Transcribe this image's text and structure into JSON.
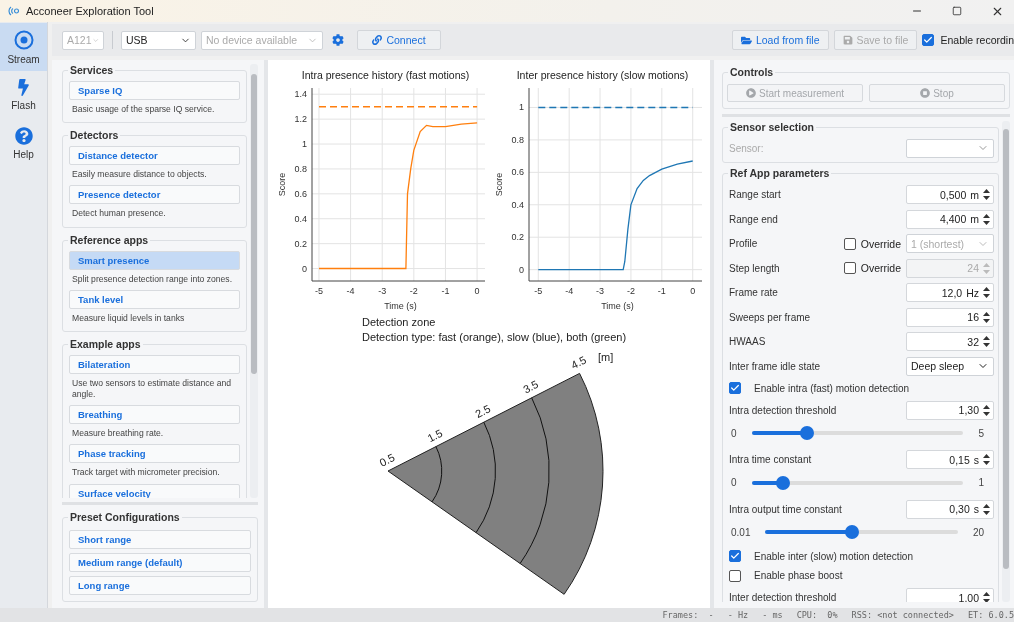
{
  "window": {
    "title": "Acconeer Exploration Tool"
  },
  "rail": [
    {
      "label": "Stream",
      "kind": "stream",
      "selected": true
    },
    {
      "label": "Flash",
      "kind": "flash",
      "selected": false
    },
    {
      "label": "Help",
      "kind": "help",
      "selected": false
    }
  ],
  "toolbar": {
    "left": [
      {
        "kind": "select",
        "value": "A121",
        "disabled": true
      },
      {
        "kind": "select",
        "value": "USB",
        "disabled": false
      },
      {
        "kind": "select",
        "value": "No device available",
        "disabled": true
      },
      {
        "kind": "settings"
      },
      {
        "kind": "connect",
        "value": "Connect",
        "disabled": false
      }
    ],
    "right": [
      {
        "kind": "load",
        "value": "Load from file",
        "disabled": false
      },
      {
        "kind": "save",
        "value": "Save to file",
        "disabled": true
      },
      {
        "kind": "checkbox",
        "value": "Enable recordin",
        "checked": true
      }
    ]
  },
  "sidebar": {
    "groups": [
      {
        "title": "Services",
        "items": [
          {
            "label": "Sparse IQ",
            "description": "Basic usage of the sparse IQ service.",
            "selected": false
          }
        ]
      },
      {
        "title": "Detectors",
        "items": [
          {
            "label": "Distance detector",
            "description": "Easily measure distance to objects.",
            "selected": false
          },
          {
            "label": "Presence detector",
            "description": "Detect human presence.",
            "selected": false
          }
        ]
      },
      {
        "title": "Reference apps",
        "items": [
          {
            "label": "Smart presence",
            "description": "Split presence detection range into zones.",
            "selected": true
          },
          {
            "label": "Tank level",
            "description": "Measure liquid levels in tanks",
            "selected": false
          }
        ]
      },
      {
        "title": "Example apps",
        "items": [
          {
            "label": "Bilateration",
            "description": "Use two sensors to estimate distance and angle.",
            "selected": false
          },
          {
            "label": "Breathing",
            "description": "Measure breathing rate.",
            "selected": false
          },
          {
            "label": "Phase tracking",
            "description": "Track target with micrometer precision.",
            "selected": false
          },
          {
            "label": "Surface velocity",
            "selected": false
          }
        ]
      }
    ],
    "presets": {
      "title": "Preset Configurations",
      "items": [
        {
          "label": "Short range",
          "selected": false
        },
        {
          "label": "Medium range (default)",
          "selected": false
        },
        {
          "label": "Long range",
          "selected": false
        }
      ]
    }
  },
  "plots": {
    "charts": [
      {
        "chart_data": {
          "type": "line",
          "grid": true,
          "title": "Intra presence history (fast motions)",
          "xlabel": "Time (s)",
          "ylabel": "Score",
          "x": [
            -5,
            -4,
            -3,
            -2.25,
            -2.2,
            -2.1,
            -2,
            -1.8,
            -1.6,
            -1.4,
            -1,
            -0.5,
            0
          ],
          "xlim": [
            -5.22,
            0.25
          ],
          "ylim": [
            -0.1,
            1.45
          ],
          "xticks": [
            -5,
            -4,
            -3,
            -2,
            -1,
            0
          ],
          "yticks": [
            0,
            0.2,
            0.4,
            0.6,
            0.8,
            1,
            1.2,
            1.4
          ],
          "series": [
            {
              "color": "#ff7f0e",
              "line_style": "dashed",
              "values": [
                1.3,
                1.3,
                1.3,
                1.3,
                1.3,
                1.3,
                1.3,
                1.3,
                1.3,
                1.3,
                1.3,
                1.3,
                1.3
              ]
            },
            {
              "color": "#ff7f0e",
              "line_style": "solid",
              "values": [
                0,
                0,
                0,
                0,
                0.6,
                0.8,
                0.95,
                1.1,
                1.15,
                1.14,
                1.14,
                1.16,
                1.17
              ]
            }
          ]
        }
      },
      {
        "chart_data": {
          "type": "line",
          "grid": true,
          "title": "Inter presence history (slow motions)",
          "xlabel": "Time (s)",
          "ylabel": "Score",
          "x": [
            -5,
            -4,
            -3,
            -2.25,
            -2.2,
            -2.1,
            -2,
            -1.8,
            -1.6,
            -1.4,
            -1,
            -0.5,
            0
          ],
          "xlim": [
            -5.3,
            0.3
          ],
          "ylim": [
            -0.07,
            1.12
          ],
          "xticks": [
            -5,
            -4,
            -3,
            -2,
            -1,
            0
          ],
          "yticks": [
            0,
            0.2,
            0.4,
            0.6,
            0.8,
            1
          ],
          "series": [
            {
              "color": "#1f77b4",
              "line_style": "dashed",
              "values": [
                1,
                1,
                1,
                1,
                1,
                1,
                1,
                1,
                1,
                1,
                1,
                1,
                1
              ]
            },
            {
              "color": "#1f77b4",
              "line_style": "solid",
              "values": [
                0,
                0,
                0,
                0,
                0.05,
                0.25,
                0.4,
                0.5,
                0.55,
                0.58,
                0.62,
                0.65,
                0.67
              ]
            }
          ]
        }
      }
    ],
    "zone": {
      "title": "Detection zone",
      "legend": "Detection type: fast (orange), slow (blue), both (green)",
      "unit": "[m]",
      "range_labels": [
        "0.5",
        "1.5",
        "2.5",
        "3.5",
        "4.5"
      ]
    }
  },
  "controls": {
    "title": "Controls",
    "buttons": [
      {
        "label": "Start measurement",
        "kind": "start",
        "disabled": true
      },
      {
        "label": "Stop",
        "kind": "stop",
        "disabled": true
      }
    ]
  },
  "sensor_selection": {
    "title": "Sensor selection",
    "label": "Sensor:",
    "disabled": true
  },
  "ref_app": {
    "title": "Ref App parameters",
    "params": [
      {
        "kind": "spin",
        "label": "Range start",
        "value": "0,500",
        "unit": "m"
      },
      {
        "kind": "spin",
        "label": "Range end",
        "value": "4,400",
        "unit": "m"
      },
      {
        "kind": "override_select",
        "label": "Profile",
        "override_label": "Override",
        "checked": false,
        "value": "1 (shortest)"
      },
      {
        "kind": "override_spin",
        "label": "Step length",
        "override_label": "Override",
        "checked": false,
        "value": "24"
      },
      {
        "kind": "spin",
        "label": "Frame rate",
        "value": "12,0",
        "unit": "Hz"
      },
      {
        "kind": "spin",
        "label": "Sweeps per frame",
        "value": "16"
      },
      {
        "kind": "spin",
        "label": "HWAAS",
        "value": "32"
      },
      {
        "kind": "select",
        "label": "Inter frame idle state",
        "value": "Deep sleep"
      },
      {
        "kind": "checkbox",
        "label": "Enable intra (fast) motion detection",
        "checked": true
      },
      {
        "kind": "slider",
        "label": "Intra detection threshold",
        "value": "1,30",
        "min": "0",
        "max": "5",
        "level": 0.26
      },
      {
        "kind": "slider",
        "label": "Intra time constant",
        "value": "0,15",
        "unit": "s",
        "min": "0",
        "max": "1",
        "level": 0.15
      },
      {
        "kind": "slider",
        "label": "Intra output time constant",
        "value": "0,30",
        "unit": "s",
        "min": "0.01",
        "max": "20",
        "level": 0.45
      },
      {
        "kind": "checkbox",
        "label": "Enable inter (slow) motion detection",
        "checked": true
      },
      {
        "kind": "checkbox",
        "label": "Enable phase boost",
        "checked": false
      },
      {
        "kind": "spin",
        "label": "Inter detection threshold",
        "value": "1,00"
      }
    ]
  },
  "status_bar": [
    "Frames:  -",
    "- Hz",
    "- ms",
    "CPU:  0%",
    "RSS: <not connected>",
    "ET: 6.0.5"
  ]
}
